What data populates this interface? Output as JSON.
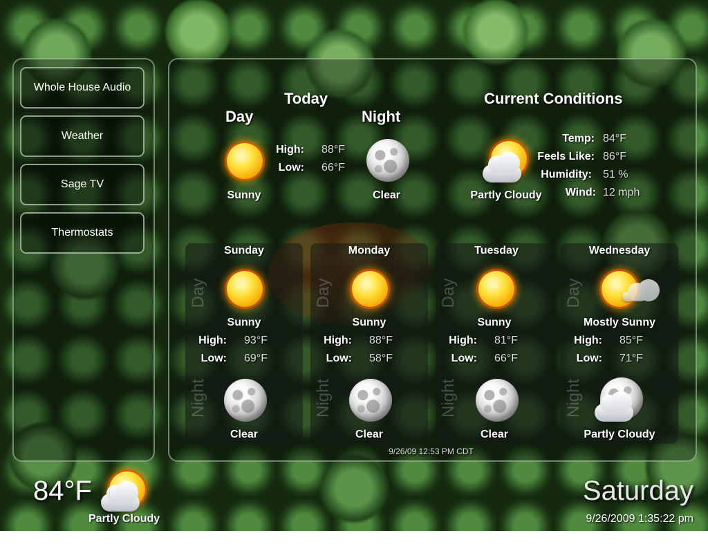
{
  "nav": {
    "items": [
      {
        "label": "Whole House Audio"
      },
      {
        "label": "Weather"
      },
      {
        "label": "Sage TV"
      },
      {
        "label": "Thermostats"
      }
    ]
  },
  "today": {
    "title": "Today",
    "day_label": "Day",
    "night_label": "Night",
    "day_icon": "sun-icon",
    "day_condition": "Sunny",
    "night_icon": "moon-icon",
    "night_condition": "Clear",
    "high_label": "High:",
    "high_value": "88°F",
    "low_label": "Low:",
    "low_value": "66°F"
  },
  "current": {
    "title": "Current Conditions",
    "icon": "partly-cloudy-icon",
    "condition": "Partly Cloudy",
    "temp_label": "Temp:",
    "temp_value": "84°F",
    "feels_label": "Feels Like:",
    "feels_value": "86°F",
    "humidity_label": "Humidity:",
    "humidity_value": "51 %",
    "wind_label": "Wind:",
    "wind_value": "12 mph"
  },
  "forecast": {
    "day_side_label": "Day",
    "night_side_label": "Night",
    "high_label": "High:",
    "low_label": "Low:",
    "days": [
      {
        "name": "Sunday",
        "day_icon": "sun-icon",
        "day_condition": "Sunny",
        "high": "93°F",
        "low": "69°F",
        "night_icon": "moon-icon",
        "night_condition": "Clear"
      },
      {
        "name": "Monday",
        "day_icon": "sun-icon",
        "day_condition": "Sunny",
        "high": "88°F",
        "low": "58°F",
        "night_icon": "moon-icon",
        "night_condition": "Clear"
      },
      {
        "name": "Tuesday",
        "day_icon": "sun-icon",
        "day_condition": "Sunny",
        "high": "81°F",
        "low": "66°F",
        "night_icon": "moon-icon",
        "night_condition": "Clear"
      },
      {
        "name": "Wednesday",
        "day_icon": "mostly-sunny-icon",
        "day_condition": "Mostly Sunny",
        "high": "85°F",
        "low": "71°F",
        "night_icon": "partly-cloudy-night-icon",
        "night_condition": "Partly Cloudy"
      }
    ]
  },
  "updated": "9/26/09 12:53 PM CDT",
  "footer": {
    "temp": "84°F",
    "condition": "Partly Cloudy",
    "icon": "partly-cloudy-icon",
    "weekday": "Saturday",
    "datetime": "9/26/2009 1:35:22 pm"
  }
}
